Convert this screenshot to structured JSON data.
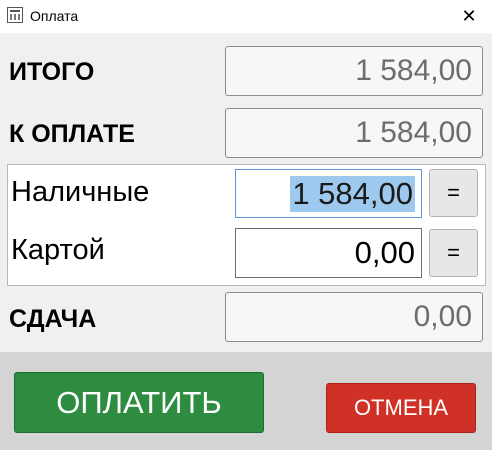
{
  "window": {
    "title": "Оплата",
    "close_glyph": "✕",
    "icon": "app-window-icon"
  },
  "total": {
    "label": "ИТОГО",
    "value": "1 584,00"
  },
  "to_pay": {
    "label": "К ОПЛАТЕ",
    "value": "1 584,00"
  },
  "cash": {
    "label": "Наличные",
    "value": "1 584,00",
    "equals_label": "="
  },
  "card": {
    "label": "Картой",
    "value": "0,00",
    "equals_label": "="
  },
  "change": {
    "label": "СДАЧА",
    "value": "0,00"
  },
  "actions": {
    "pay_label": "ОПЛАТИТЬ",
    "cancel_label": "ОТМЕНА"
  },
  "colors": {
    "pay_button": "#2e8c41",
    "cancel_button": "#cf3127",
    "selection": "#9ec9ee"
  }
}
